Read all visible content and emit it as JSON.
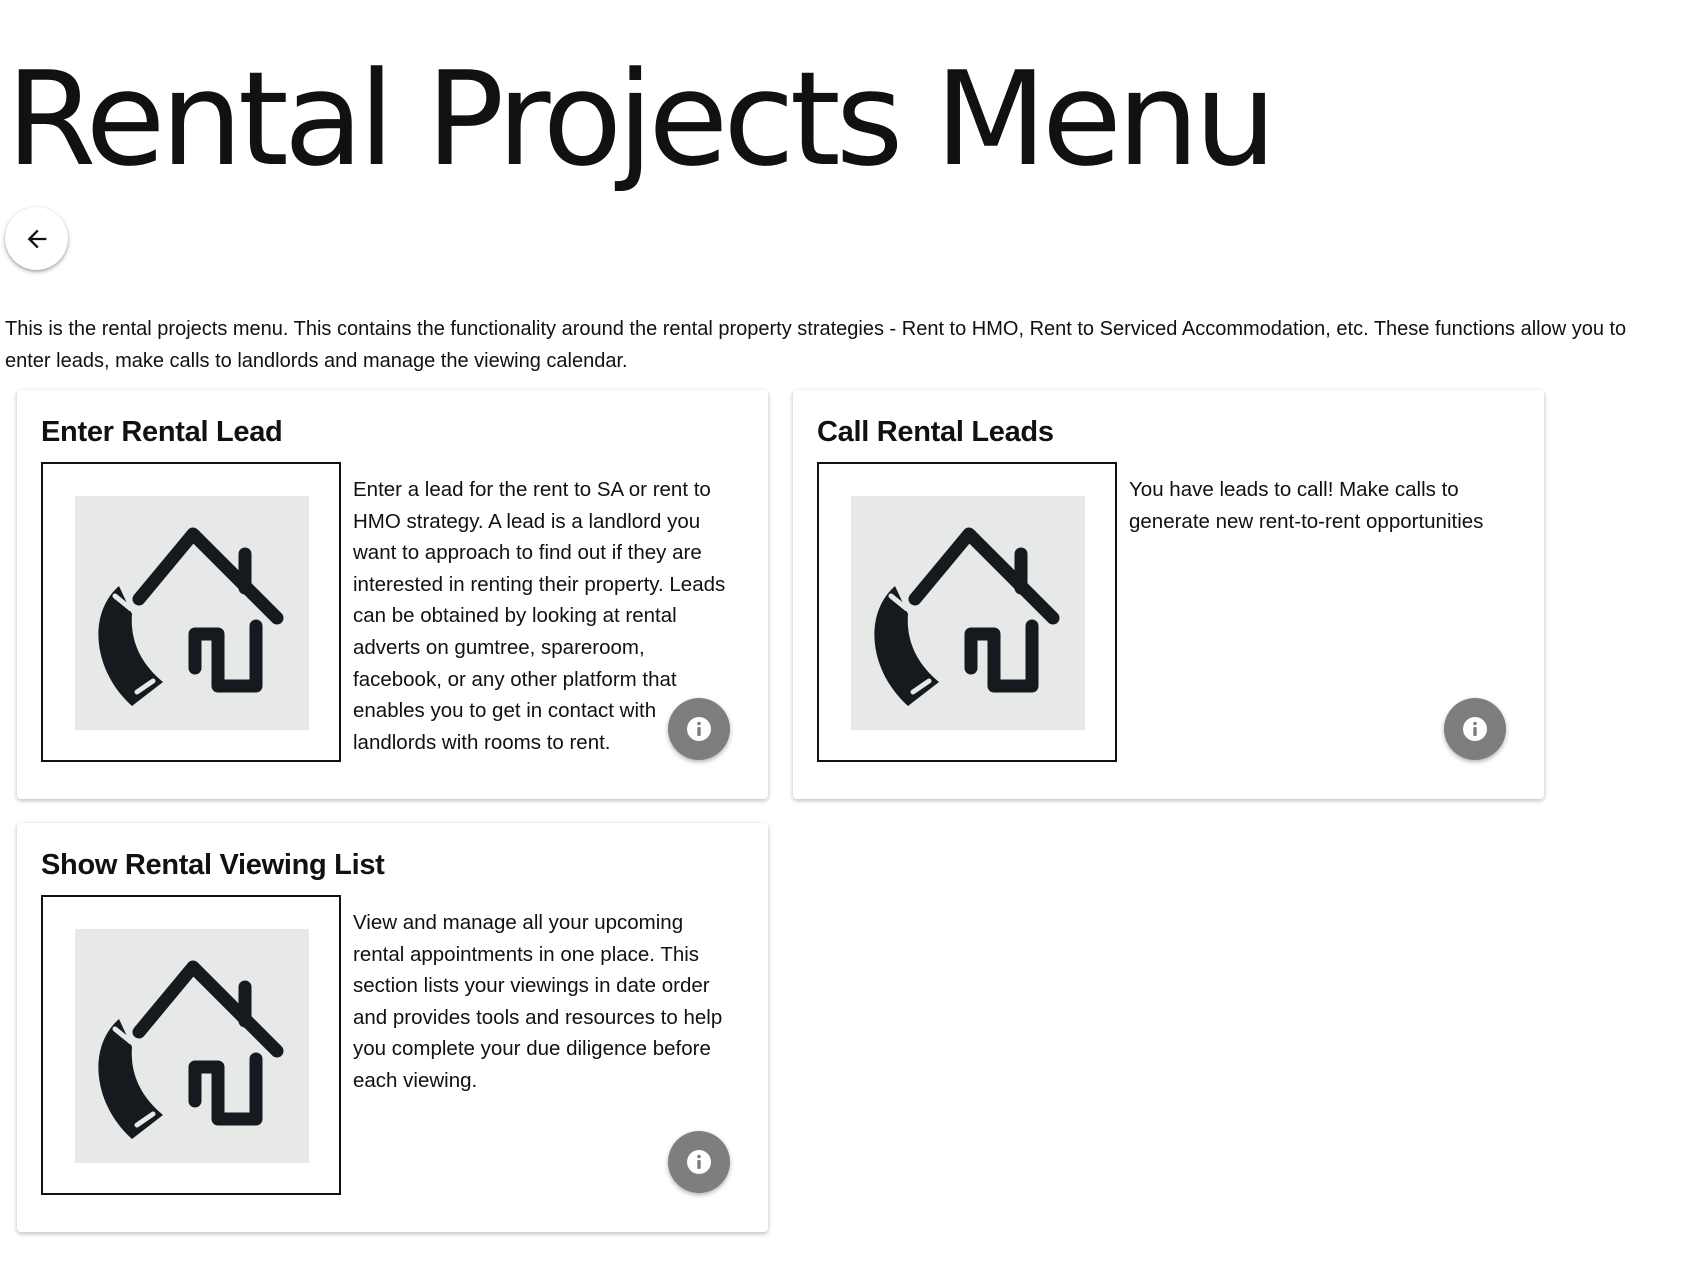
{
  "page": {
    "title": "Rental Projects Menu",
    "back_icon": "arrow-left-icon",
    "intro": "This is the rental projects menu. This contains the functionality around the rental property strategies - Rent to HMO, Rent to Serviced Accommodation, etc. These functions allow you to enter leads, make calls to landlords and manage the viewing calendar."
  },
  "cards": [
    {
      "title": "Enter Rental Lead",
      "image_icon": "phone-house-icon",
      "description": "Enter a lead for the rent to SA or rent to HMO strategy. A lead is a landlord you want to approach to find out if they are interested in renting their property. Leads can be obtained by looking at rental adverts on gumtree, spareroom, facebook, or any other platform that enables you to get in contact with landlords with rooms to rent.",
      "info_icon": "info-icon"
    },
    {
      "title": "Call Rental Leads",
      "image_icon": "phone-house-icon",
      "description": "You have leads to call! Make calls to generate new rent-to-rent opportunities",
      "info_icon": "info-icon"
    },
    {
      "title": "Show Rental Viewing List",
      "image_icon": "phone-house-icon",
      "description": "View and manage all your upcoming rental appointments in one place. This section lists your viewings in date order and provides tools and resources to help you complete your due diligence before each viewing.",
      "info_icon": "info-icon"
    }
  ],
  "colors": {
    "info_button": "#7e7e7e",
    "image_tile": "#e7e8e8",
    "icon_ink": "#161a1e"
  }
}
